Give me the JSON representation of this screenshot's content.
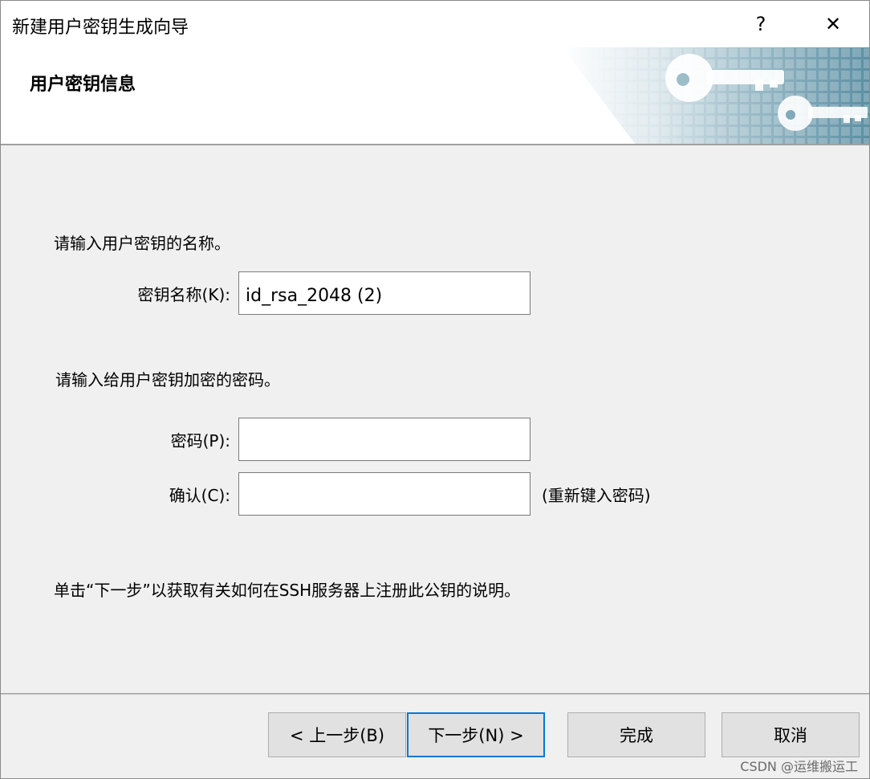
{
  "window": {
    "title": "新建用户密钥生成向导",
    "help_glyph": "?",
    "close_glyph": "✕"
  },
  "header": {
    "title": "用户密钥信息",
    "banner_icon": "keys-banner-icon"
  },
  "content": {
    "name_prompt": "请输入用户密钥的名称。",
    "key_name_label": "密钥名称(K):",
    "key_name_value": "id_rsa_2048 (2)",
    "password_prompt": "请输入给用户密钥加密的密码。",
    "password_label": "密码(P):",
    "password_value": "",
    "confirm_label": "确认(C):",
    "confirm_value": "",
    "confirm_hint": "(重新键入密码)",
    "next_info": "单击“下一步”以获取有关如何在SSH服务器上注册此公钥的说明。"
  },
  "buttons": {
    "back": "< 上一步(B)",
    "next": "下一步(N) >",
    "finish": "完成",
    "cancel": "取消"
  },
  "watermark": "CSDN @运维搬运工",
  "colors": {
    "dialog_bg": "#f0f0f0",
    "header_bg": "#ffffff",
    "banner_teal": "#5b8fa3",
    "default_button_border": "#0078d7"
  }
}
